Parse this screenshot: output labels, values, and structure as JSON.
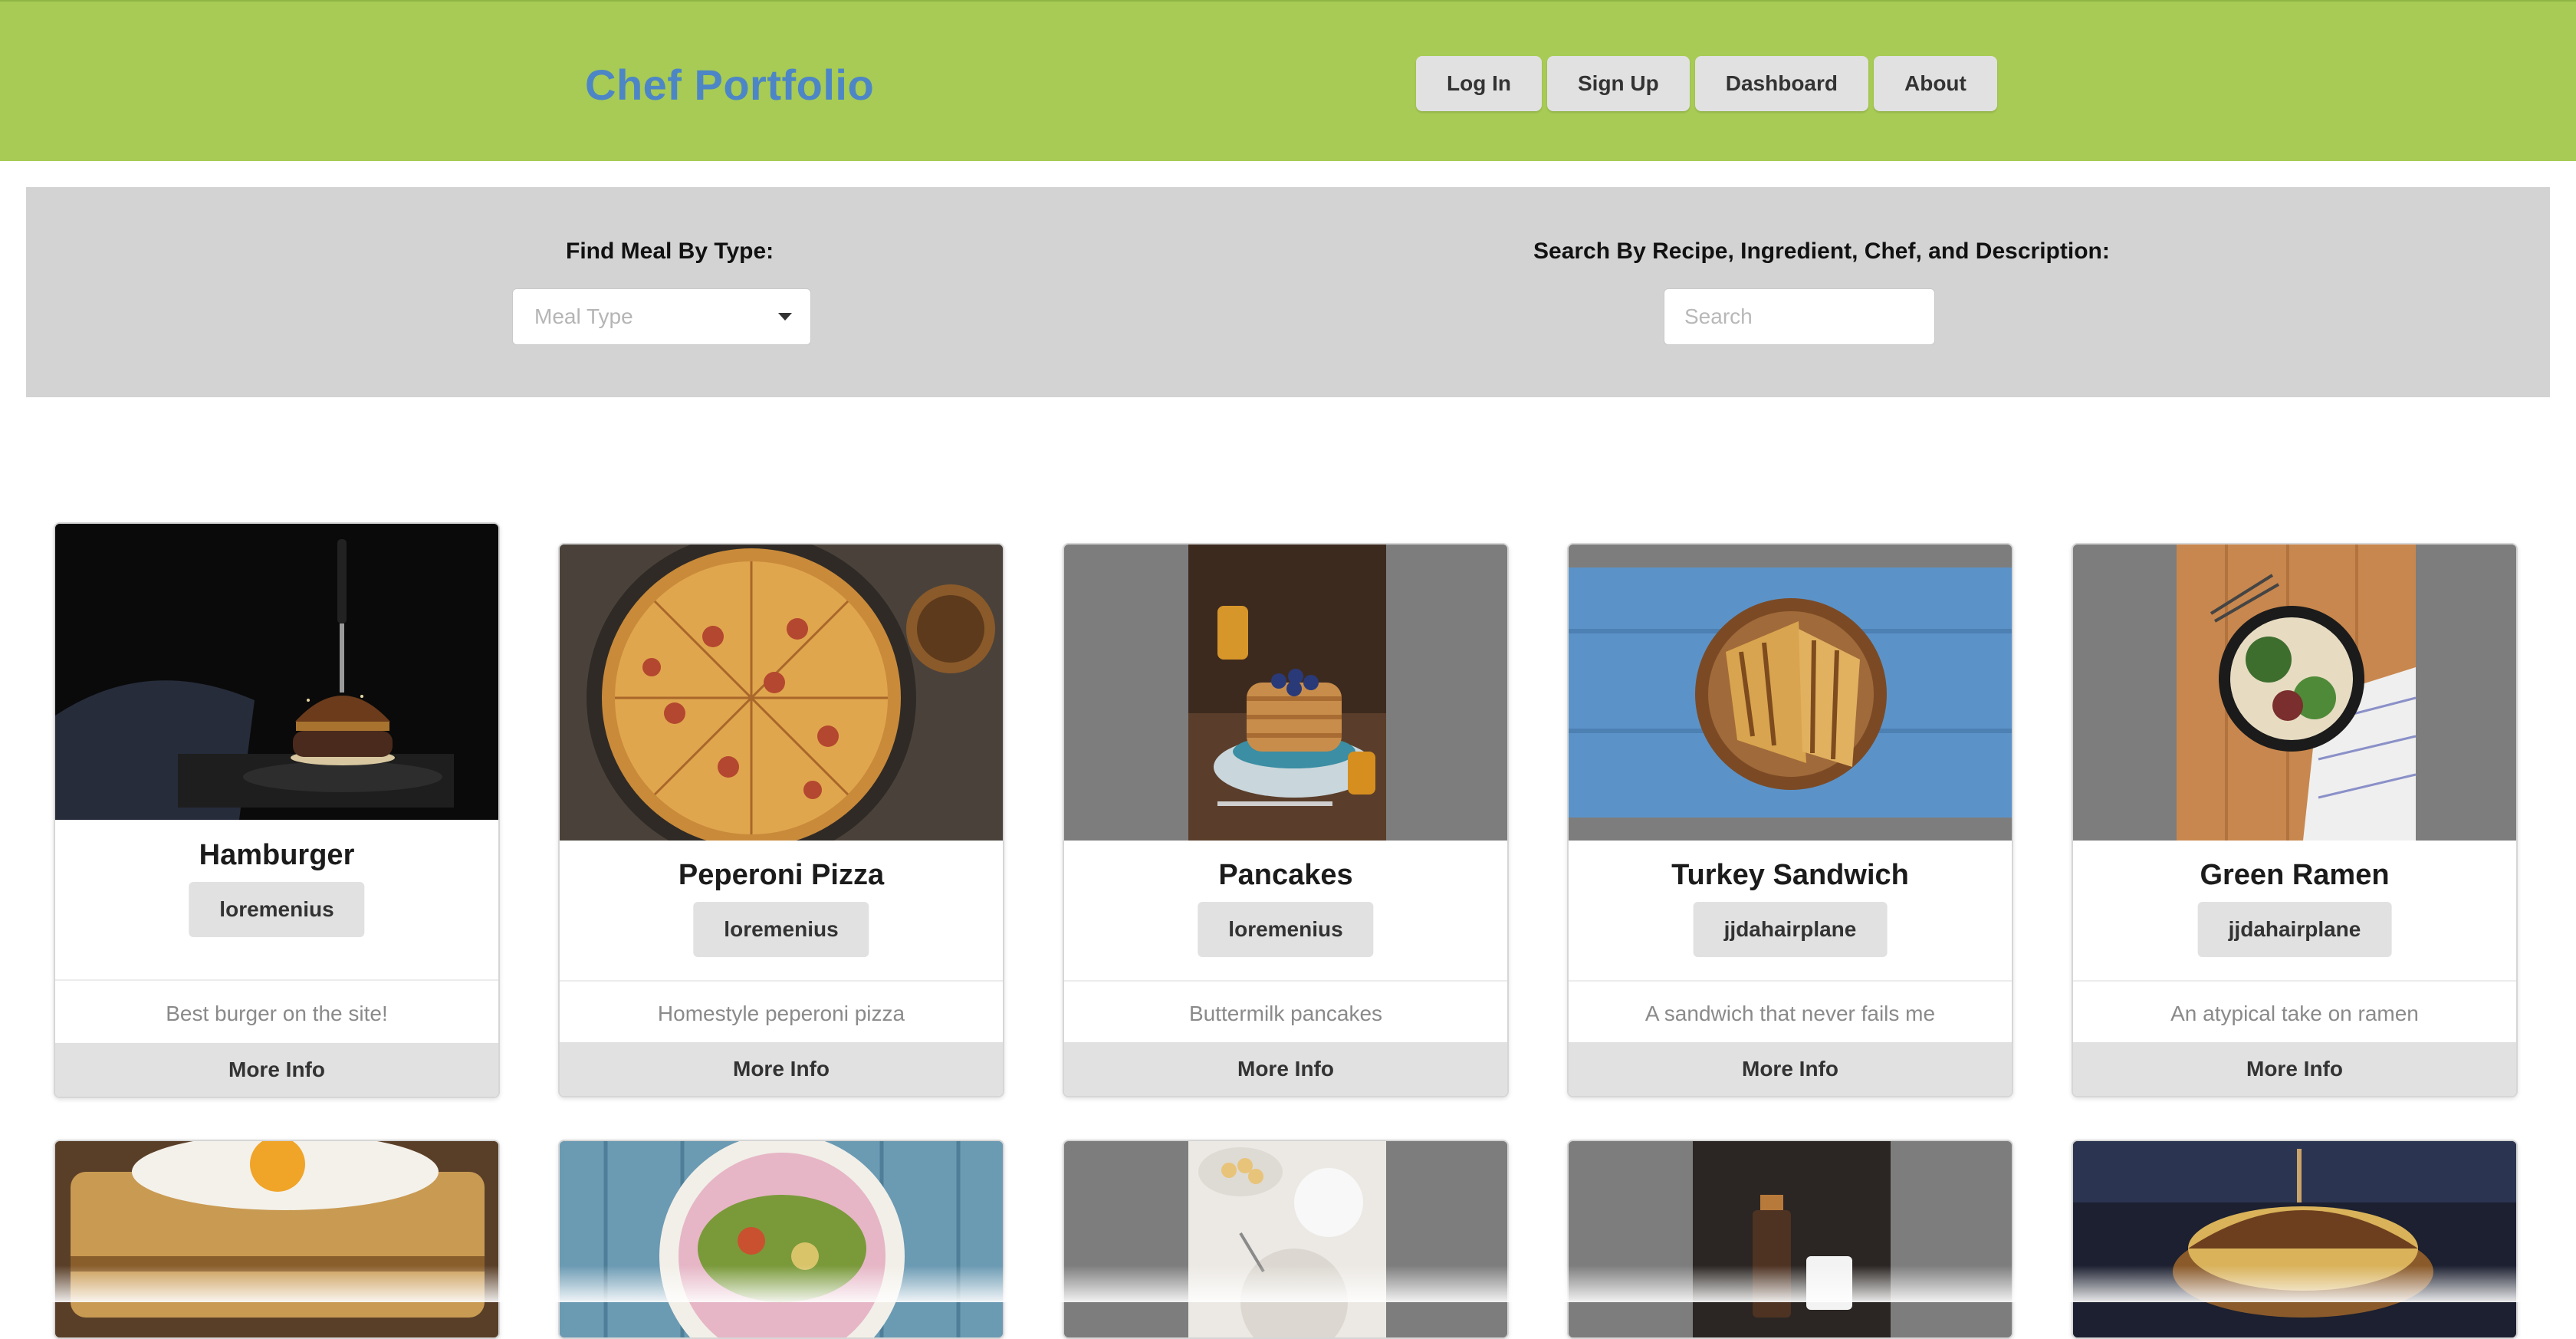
{
  "header": {
    "brand": "Chef Portfolio",
    "nav": [
      "Log In",
      "Sign Up",
      "Dashboard",
      "About"
    ]
  },
  "filters": {
    "type_label": "Find Meal By Type:",
    "type_placeholder": "Meal Type",
    "search_label": "Search By Recipe, Ingredient, Chef, and Description:",
    "search_placeholder": "Search"
  },
  "cards": [
    {
      "title": "Hamburger",
      "chef": "loremenius",
      "description": "Best burger on the site!",
      "more": "More Info"
    },
    {
      "title": "Peperoni Pizza",
      "chef": "loremenius",
      "description": "Homestyle peperoni pizza",
      "more": "More Info"
    },
    {
      "title": "Pancakes",
      "chef": "loremenius",
      "description": "Buttermilk pancakes",
      "more": "More Info"
    },
    {
      "title": "Turkey Sandwich",
      "chef": "jjdahairplane",
      "description": "A sandwich that never fails me",
      "more": "More Info"
    },
    {
      "title": "Green Ramen",
      "chef": "jjdahairplane",
      "description": "An atypical take on ramen",
      "more": "More Info"
    }
  ],
  "colors": {
    "header_bg": "#a7cb54",
    "brand": "#4d86c6",
    "filter_bg": "#d3d3d3",
    "button_bg": "#e1e1e1"
  }
}
